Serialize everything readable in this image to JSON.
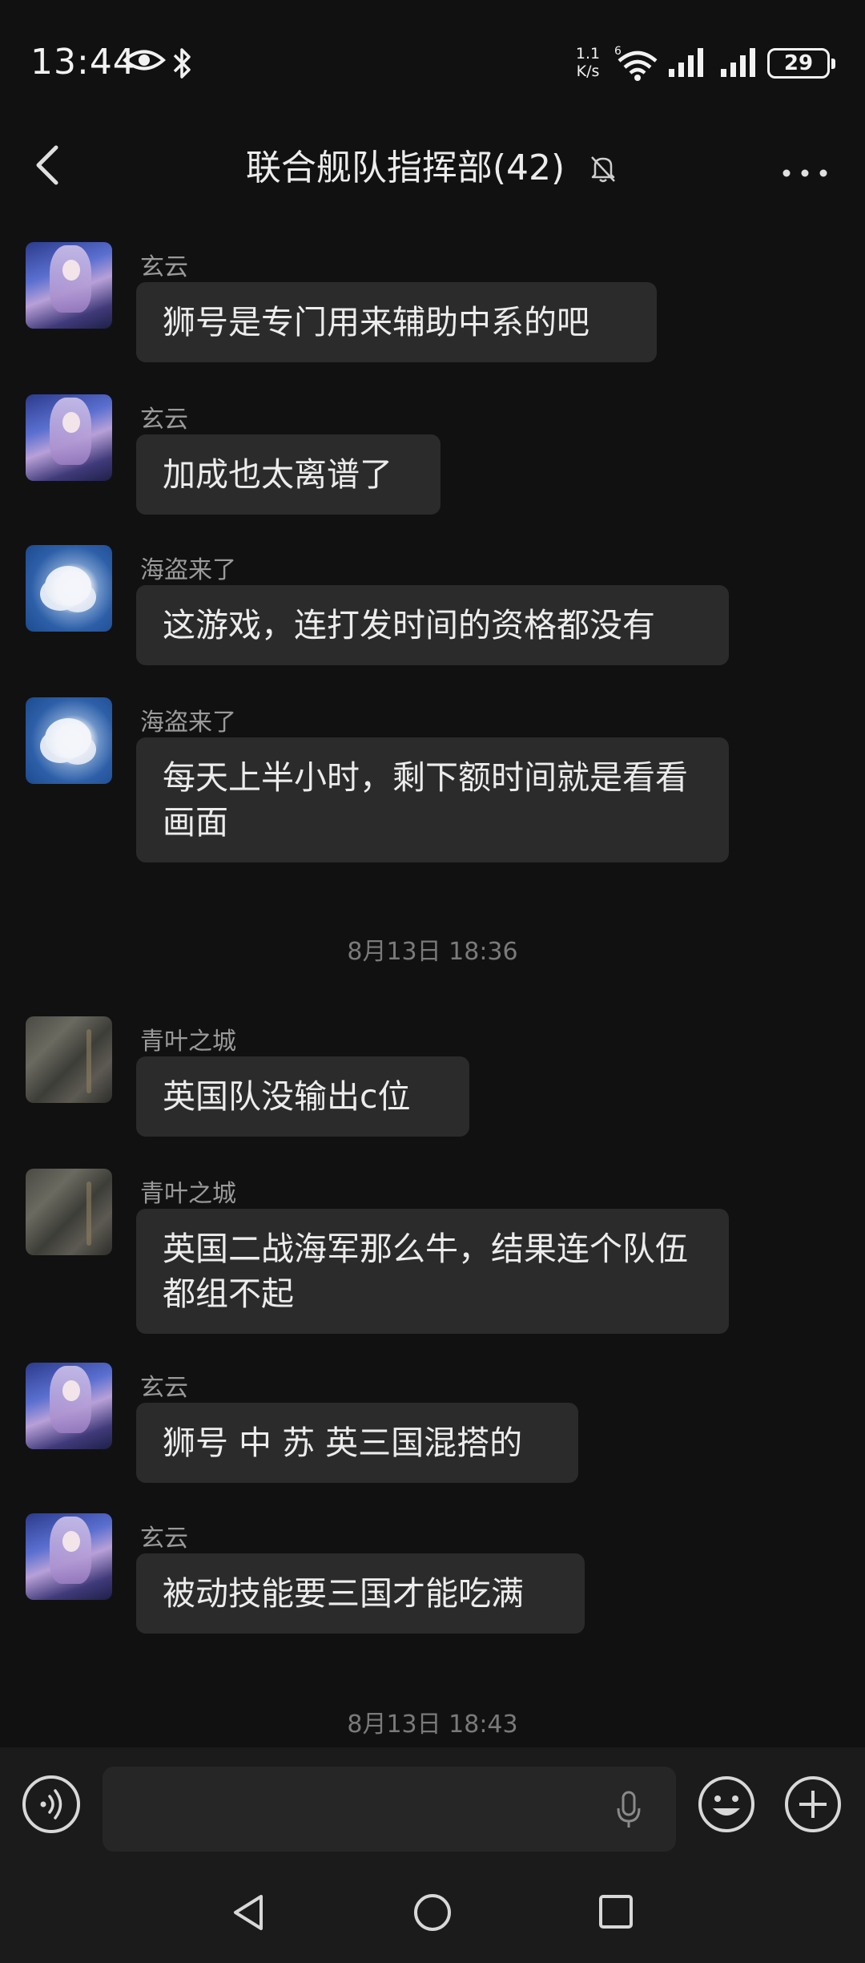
{
  "status_bar": {
    "time": "13:44",
    "net_speed_value": "1.1",
    "net_speed_unit": "K/s",
    "battery": "29",
    "icons": [
      "eye-icon",
      "bluetooth-icon",
      "wifi-icon",
      "signal-icon",
      "signal-icon",
      "battery-icon"
    ]
  },
  "header": {
    "title": "联合舰队指挥部(42)",
    "icons": [
      "back-icon",
      "mute-bell-icon",
      "more-icon"
    ]
  },
  "messages": [
    {
      "sender": "玄云",
      "text": "狮号是专门用来辅助中系的吧",
      "avatar": "anime-girl"
    },
    {
      "sender": "玄云",
      "text": "加成也太离谱了",
      "avatar": "anime-girl"
    },
    {
      "sender": "海盗来了",
      "text": "这游戏，连打发时间的资格都没有",
      "avatar": "sky-cloud"
    },
    {
      "sender": "海盗来了",
      "text": "每天上半小时，剩下额时间就是看看画面",
      "avatar": "sky-cloud"
    },
    {
      "sender": "青叶之城",
      "text": "英国队没输出c位",
      "avatar": "water"
    },
    {
      "sender": "青叶之城",
      "text": "英国二战海军那么牛，结果连个队伍都组不起",
      "avatar": "water"
    },
    {
      "sender": "玄云",
      "text": "狮号 中 苏 英三国混搭的",
      "avatar": "anime-girl"
    },
    {
      "sender": "玄云",
      "text": "被动技能要三国才能吃满",
      "avatar": "anime-girl"
    }
  ],
  "timestamps": [
    "8月13日 18:36",
    "8月13日 18:43"
  ],
  "input_bar": {
    "placeholder": "",
    "icons": [
      "voice-icon",
      "mic-icon",
      "emoji-icon",
      "plus-icon"
    ]
  },
  "nav_bar": {
    "icons": [
      "nav-back-icon",
      "nav-home-icon",
      "nav-recent-icon"
    ]
  },
  "colors": {
    "background": "#111111",
    "bubble": "#2b2b2b",
    "sender": "#9a9a9a",
    "timestamp": "#7a7a7a",
    "text": "#ececec"
  }
}
